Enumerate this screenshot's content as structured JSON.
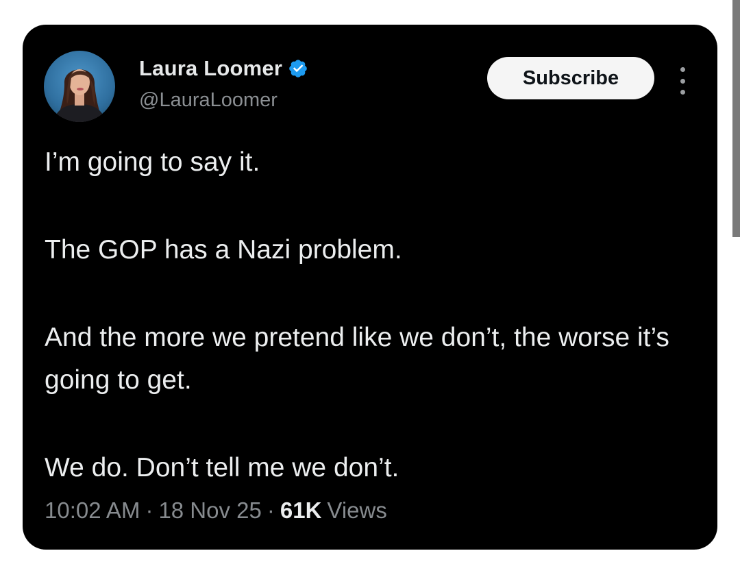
{
  "author": {
    "name": "Laura Loomer",
    "handle": "@LauraLoomer",
    "verified": true,
    "avatar_icon": "profile-photo-avatar"
  },
  "actions": {
    "subscribe_label": "Subscribe",
    "more_icon": "more-vertical-icon"
  },
  "tweet": {
    "paragraphs": [
      "I’m going to say it.",
      "The GOP has a Nazi problem.",
      "And the more we pretend like we don’t, the worse it’s going to get.",
      "We do. Don’t tell me we don’t."
    ],
    "time": "10:02 AM",
    "separator": "·",
    "date": "18 Nov 25",
    "views_count": "61K",
    "views_label": "Views"
  },
  "colors": {
    "card_background": "#000000",
    "text_primary": "#e7e9ea",
    "text_secondary": "#878b8f",
    "verified_blue": "#1d9bf0",
    "subscribe_background": "#f5f5f5"
  }
}
